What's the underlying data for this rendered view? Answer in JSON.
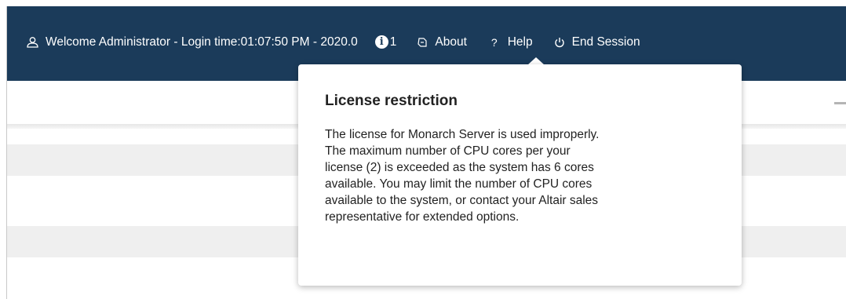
{
  "header": {
    "welcome_text": "Welcome Administrator - Login time:01:07:50 PM - 2020.0",
    "notification_count": "1",
    "about_label": "About",
    "help_label": "Help",
    "end_session_label": "End Session",
    "colors": {
      "background": "#1b3b5a",
      "text": "#ffffff"
    },
    "icons": {
      "user": "user-icon",
      "notification": "info-icon",
      "about": "about-icon",
      "help": "question-icon",
      "end_session": "power-icon"
    }
  },
  "popover": {
    "title": "License restriction",
    "message": "The license for Monarch Server is used improperly.\nThe maximum number of CPU cores per your\nlicense (2) is exceeded as the system has 6 cores\navailable. You may limit the number of CPU cores\navailable to the system, or contact your Altair sales\nrepresentative for extended options."
  }
}
